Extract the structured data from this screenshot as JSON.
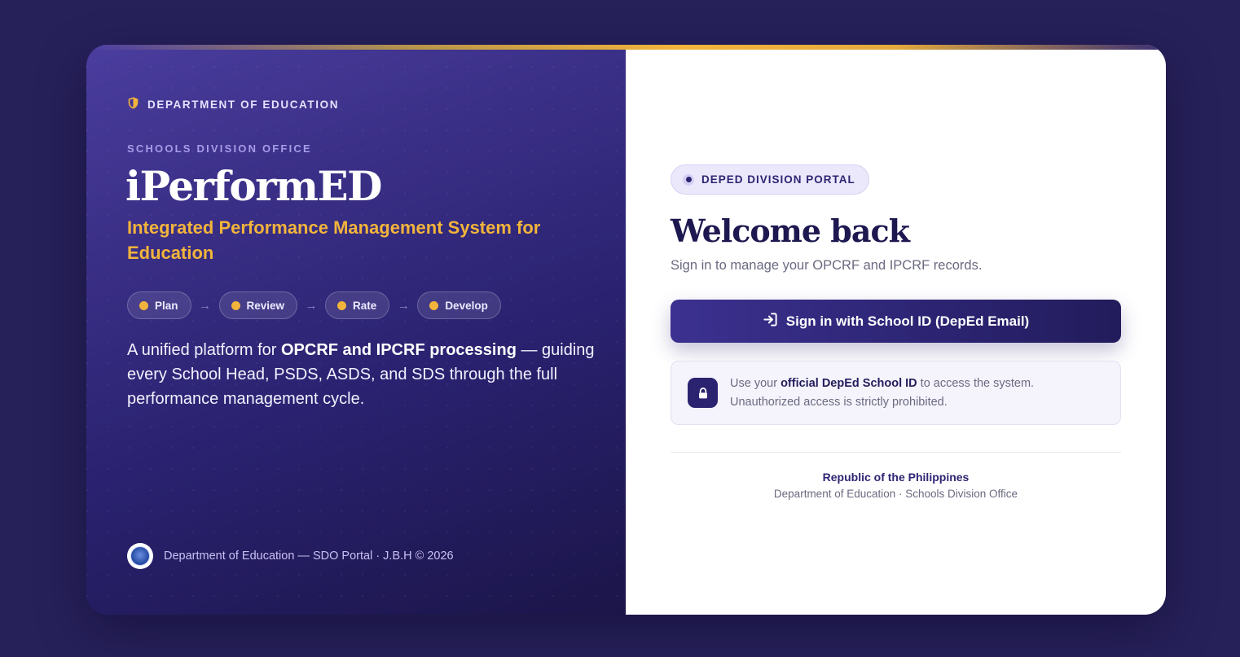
{
  "left": {
    "department": "DEPARTMENT OF EDUCATION",
    "office_label": "SCHOOLS DIVISION OFFICE",
    "brand": "iPerformED",
    "tagline": "Integrated Performance Management System for Education",
    "steps": [
      {
        "label": "Plan"
      },
      {
        "label": "Review"
      },
      {
        "label": "Rate"
      },
      {
        "label": "Develop"
      }
    ],
    "step_arrow": "→",
    "description": {
      "prefix": "A unified platform for ",
      "highlight": "OPCRF and IPCRF processing",
      "suffix": " — guiding every School Head, PSDS, ASDS, and SDS through the full performance management cycle."
    },
    "footer": "Department of Education — SDO Portal · J.B.H © 2026"
  },
  "right": {
    "badge": "DEPED DIVISION PORTAL",
    "welcome": "Welcome back",
    "subtitle": "Sign in to manage your OPCRF and IPCRF records.",
    "signin_label": "Sign in with School ID (DepEd Email)",
    "notice": {
      "prefix": "Use your ",
      "highlight": "official DepEd School ID",
      "suffix": " to access the system.",
      "line2": "Unauthorized access is strictly prohibited."
    },
    "republic": "Republic of the Philippines",
    "org": "Department of Education · Schools Division Office"
  },
  "icons": {
    "department": "shield-icon",
    "signin": "sign-in-icon",
    "notice": "lock-icon",
    "footer": "deped-seal-icon"
  },
  "colors": {
    "background": "#27215a",
    "accent_gold": "#f2b43b",
    "primary_navy": "#2d2574",
    "panel_white": "#ffffff"
  }
}
